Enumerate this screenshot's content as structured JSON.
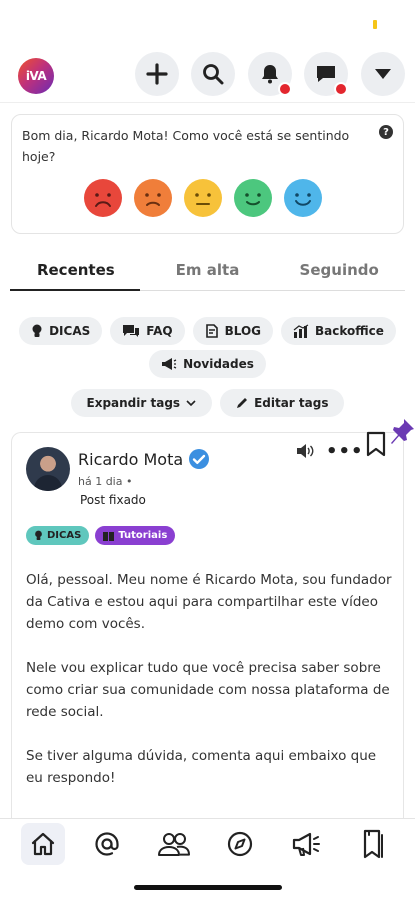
{
  "header": {
    "logo_text": "iVA",
    "buttons": [
      {
        "icon": "plus-icon",
        "badge": false
      },
      {
        "icon": "search-icon",
        "badge": false
      },
      {
        "icon": "bell-icon",
        "badge": true
      },
      {
        "icon": "chat-icon",
        "badge": true
      },
      {
        "icon": "caret-down-icon",
        "badge": false
      }
    ]
  },
  "mood": {
    "question": "Bom dia, Ricardo Mota! Como você está se sentindo hoje?",
    "help_label": "?",
    "faces": [
      {
        "name": "very-sad",
        "color": "#e8473b"
      },
      {
        "name": "sad",
        "color": "#f07e3a"
      },
      {
        "name": "neutral",
        "color": "#f7c23a"
      },
      {
        "name": "happy",
        "color": "#4cc77e"
      },
      {
        "name": "very-happy",
        "color": "#4fb6ea"
      }
    ]
  },
  "tabs": [
    {
      "label": "Recentes",
      "active": true
    },
    {
      "label": "Em alta",
      "active": false
    },
    {
      "label": "Seguindo",
      "active": false
    }
  ],
  "tags": {
    "row1": [
      "DICAS",
      "FAQ",
      "BLOG",
      "Backoffice"
    ],
    "row2": [
      "Novidades"
    ],
    "expand_label": "Expandir tags",
    "edit_label": "Editar tags"
  },
  "post": {
    "author": "Ricardo Mota",
    "time": "há 1 dia •",
    "pinned_label": "Post fixado",
    "tags": [
      "DICAS",
      "Tutoriais"
    ],
    "paragraphs": [
      "Olá, pessoal. Meu nome é Ricardo Mota, sou fundador da Cativa e estou aqui para compartilhar este vídeo demo com vocês.",
      "Nele vou explicar tudo que você precisa saber sobre como criar sua comunidade com nossa plataforma de rede social.",
      "Se tiver alguma dúvida, comenta aqui embaixo que eu respondo!"
    ],
    "menu_label": "•••"
  },
  "bottom_nav": [
    "home-icon",
    "mention-icon",
    "people-icon",
    "compass-icon",
    "megaphone-icon",
    "bookmarks-icon"
  ],
  "colors": {
    "accent_purple": "#8a3fd1",
    "teal": "#5fc7bd",
    "badge_red": "#e3262e",
    "verified_blue": "#3b8fe0"
  }
}
